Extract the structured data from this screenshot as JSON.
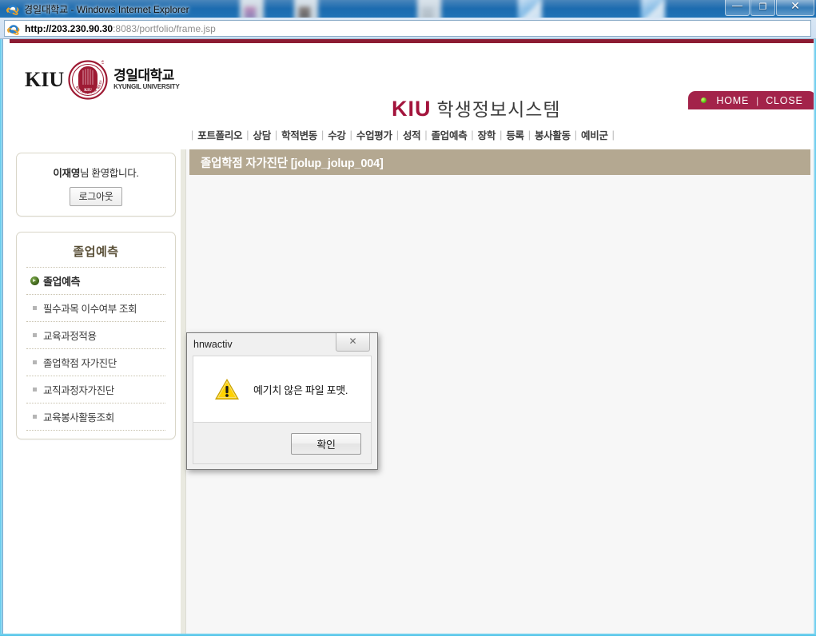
{
  "browser": {
    "window_title": "경일대학교 - Windows Internet Explorer",
    "url_host": "http://203.230.90.30",
    "url_rest": ":8083/portfolio/frame.jsp",
    "minimize_glyph": "—",
    "maximize_glyph": "❐",
    "close_glyph": "✕"
  },
  "header": {
    "logo_kiu": "KIU",
    "logo_seal_top": "KYUNGIL UNIVERSITY",
    "logo_seal_bottom": "BEYOND THE BEST",
    "logo_seal_center": "KIU",
    "logo_korean_main": "경일대학교",
    "logo_korean_sub": "KYUNGIL UNIVERSITY",
    "system_title_kiu": "KIU",
    "system_title_kr": "학생정보시스템",
    "home_label": "HOME",
    "separator": "|",
    "close_label": "CLOSE"
  },
  "nav": {
    "items": [
      {
        "label": "포트폴리오"
      },
      {
        "label": "상담"
      },
      {
        "label": "학적변동"
      },
      {
        "label": "수강"
      },
      {
        "label": "수업평가"
      },
      {
        "label": "성적"
      },
      {
        "label": "졸업예측"
      },
      {
        "label": "장학"
      },
      {
        "label": "등록"
      },
      {
        "label": "봉사활동"
      },
      {
        "label": "예비군"
      }
    ],
    "divider": "|"
  },
  "sidebar": {
    "welcome_name": "이재영",
    "welcome_suffix": "님 환영합니다.",
    "logout_label": "로그아웃",
    "menu_title": "졸업예측",
    "items": [
      {
        "label": "졸업예측",
        "active": true
      },
      {
        "label": "필수과목 이수여부 조회",
        "active": false
      },
      {
        "label": "교육과정적용",
        "active": false
      },
      {
        "label": "졸업학점 자가진단",
        "active": false
      },
      {
        "label": "교직과정자가진단",
        "active": false
      },
      {
        "label": "교육봉사활동조회",
        "active": false
      }
    ]
  },
  "content": {
    "page_title": "졸업학점 자가진단 [jolup_jolup_004]"
  },
  "dialog": {
    "title": "hnwactiv",
    "close_glyph": "✕",
    "message": "예기치 않은 파일 포맷.",
    "ok_label": "확인"
  },
  "colors": {
    "brand_red": "#a3143c",
    "top_rule": "#8c1c33",
    "pill_bg": "#a3234a",
    "title_bar_taupe": "#b4a891",
    "menu_title": "#5a5038"
  }
}
